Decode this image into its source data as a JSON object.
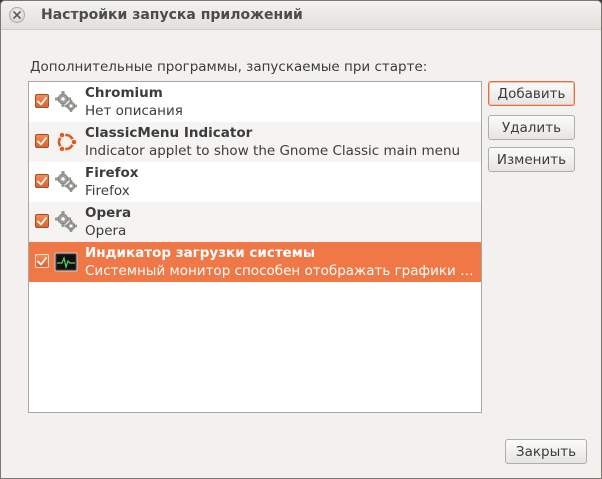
{
  "window": {
    "title": "Настройки запуска приложений"
  },
  "section_label": "Дополнительные программы, запускаемые при старте:",
  "apps": [
    {
      "name": "Chromium",
      "description": "Нет описания",
      "enabled": true,
      "icon": "gear-icon",
      "selected": false
    },
    {
      "name": "ClassicMenu Indicator",
      "description": "Indicator applet to show the Gnome Classic main menu",
      "enabled": true,
      "icon": "ubuntu-logo-icon",
      "selected": false
    },
    {
      "name": "Firefox",
      "description": "Firefox",
      "enabled": true,
      "icon": "gear-icon",
      "selected": false
    },
    {
      "name": "Opera",
      "description": "Opera",
      "enabled": true,
      "icon": "gear-icon",
      "selected": false
    },
    {
      "name": "Индикатор загрузки системы",
      "description": "Системный монитор способен отображать графики з…",
      "enabled": true,
      "icon": "system-monitor-icon",
      "selected": true
    }
  ],
  "buttons": {
    "add": "Добавить",
    "remove": "Удалить",
    "edit": "Изменить",
    "close": "Закрыть"
  },
  "colors": {
    "accent": "#f07746",
    "window_bg": "#f2f1f0"
  }
}
